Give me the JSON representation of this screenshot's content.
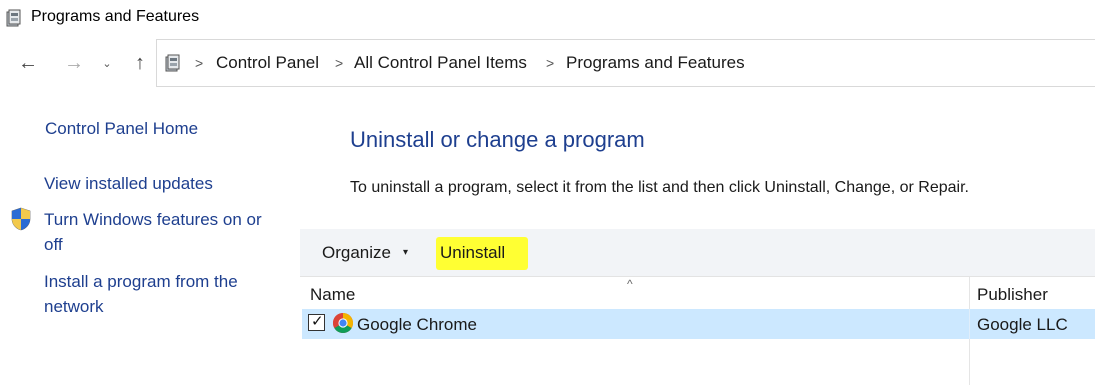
{
  "window": {
    "title": "Programs and Features"
  },
  "nav": {
    "back": "←",
    "forward": "→",
    "recent": "⌄",
    "up": "↑"
  },
  "breadcrumb": {
    "items": [
      "Control Panel",
      "All Control Panel Items",
      "Programs and Features"
    ],
    "separator": ">"
  },
  "sidebar": {
    "home": "Control Panel Home",
    "view_updates": "View installed updates",
    "windows_features_line1": "Turn Windows features on or",
    "windows_features_line2": "off",
    "install_network_line1": "Install a program from the",
    "install_network_line2": "network"
  },
  "main": {
    "heading": "Uninstall or change a program",
    "description": "To uninstall a program, select it from the list and then click Uninstall, Change, or Repair."
  },
  "toolbar": {
    "organize": "Organize",
    "organize_arrow": "▾",
    "uninstall": "Uninstall",
    "highlight_color": "#ffff33"
  },
  "list": {
    "sort_indicator": "^",
    "columns": [
      "Name",
      "Publisher"
    ],
    "rows": [
      {
        "name": "Google Chrome",
        "publisher": "Google LLC",
        "checked": true,
        "check_glyph": "✓",
        "icon": "chrome-icon"
      }
    ],
    "selected_color": "#cce8ff"
  },
  "colors": {
    "link": "#1e3f8f",
    "heading": "#1e3f8f",
    "toolbar_bg": "#f2f4f7"
  }
}
